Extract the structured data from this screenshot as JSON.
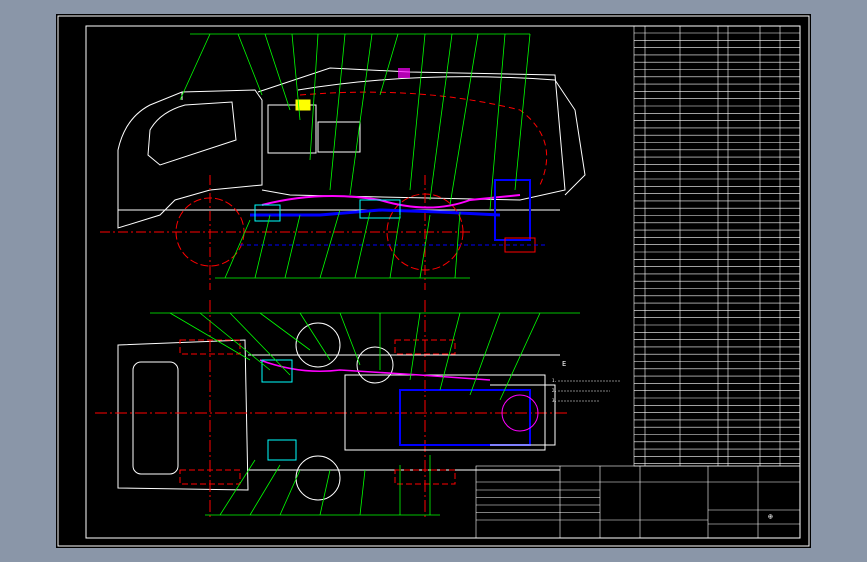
{
  "drawing": {
    "note_marker": "E",
    "note_lines": [
      "1.",
      "2.",
      "3."
    ],
    "title_block": {
      "grid_symbol": "⊕"
    }
  },
  "colors": {
    "background": "#8a96a8",
    "sheet": "#000000",
    "outline": "#ffffff",
    "leader": "#00ff00",
    "wheel": "#ff0000",
    "hydraulic": "#0000ff",
    "pipe": "#ff00ff",
    "cyan": "#00ffff",
    "yellow": "#ffff00"
  }
}
